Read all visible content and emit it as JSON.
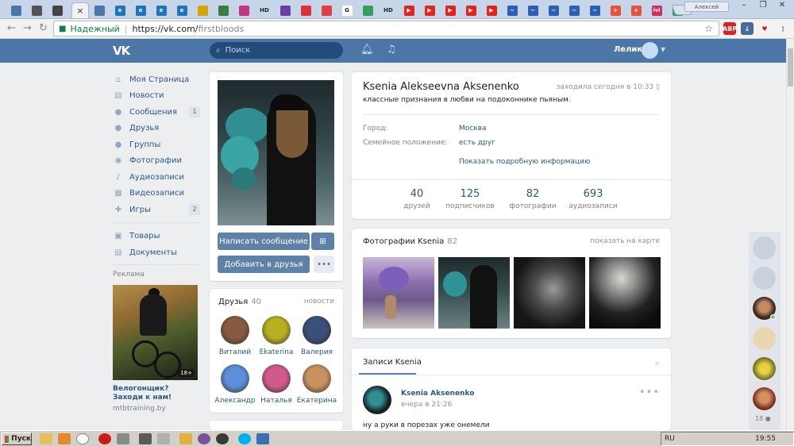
{
  "browser": {
    "window_user": "Алексей",
    "active_tab_close": "×",
    "tabs": [
      {
        "icon": "vk",
        "color": "#4a76a8",
        "text": ""
      },
      {
        "icon": "generic",
        "color": "#555",
        "text": ""
      },
      {
        "icon": "generic",
        "color": "#444",
        "text": ""
      },
      {
        "icon": "vk",
        "color": "#4a76a8",
        "text": ""
      },
      {
        "icon": "ie",
        "color": "#1e73be",
        "text": "e"
      },
      {
        "icon": "ie",
        "color": "#1e73be",
        "text": "e"
      },
      {
        "icon": "ie",
        "color": "#1e73be",
        "text": "e"
      },
      {
        "icon": "ie",
        "color": "#1e73be",
        "text": "e"
      },
      {
        "icon": "generic",
        "color": "#d8a200",
        "text": ""
      },
      {
        "icon": "generic",
        "color": "#3a7d44",
        "text": ""
      },
      {
        "icon": "instagram",
        "color": "#c13584",
        "text": ""
      },
      {
        "icon": "hd",
        "color": "#c6d5e8",
        "text": "HD"
      },
      {
        "icon": "generic",
        "color": "#6b3fa0",
        "text": ""
      },
      {
        "icon": "generic",
        "color": "#d33",
        "text": ""
      },
      {
        "icon": "generic",
        "color": "#e04040",
        "text": ""
      },
      {
        "icon": "google",
        "color": "#fff",
        "text": "G"
      },
      {
        "icon": "generic",
        "color": "#3a9d5d",
        "text": ""
      },
      {
        "icon": "hd",
        "color": "#c6d5e8",
        "text": "HD"
      },
      {
        "icon": "youtube",
        "color": "#e62117",
        "text": "▶"
      },
      {
        "icon": "youtube",
        "color": "#e62117",
        "text": "▶"
      },
      {
        "icon": "youtube",
        "color": "#e62117",
        "text": "▶"
      },
      {
        "icon": "youtube",
        "color": "#e62117",
        "text": "▶"
      },
      {
        "icon": "youtube",
        "color": "#e62117",
        "text": "▶"
      },
      {
        "icon": "chart",
        "color": "#2a5fb5",
        "text": "~"
      },
      {
        "icon": "chart",
        "color": "#2a5fb5",
        "text": "~"
      },
      {
        "icon": "chart",
        "color": "#2a5fb5",
        "text": "~"
      },
      {
        "icon": "chart",
        "color": "#2a5fb5",
        "text": "~"
      },
      {
        "icon": "chart",
        "color": "#2a5fb5",
        "text": "~"
      },
      {
        "icon": "plus",
        "color": "#e8503a",
        "text": "+"
      },
      {
        "icon": "plus",
        "color": "#e8503a",
        "text": "+"
      },
      {
        "icon": "ivi",
        "color": "#d42a5a",
        "text": "ivi"
      },
      {
        "icon": "generic",
        "color": "#2aa36b",
        "text": "W"
      }
    ],
    "secure_label": "Надежный",
    "url_scheme_host": "https://vk.com/",
    "url_path": "firstbloods"
  },
  "vk": {
    "logo": "VK",
    "search_placeholder": "Поиск",
    "username": "Лелик",
    "sidebar": [
      {
        "icon": "home-icon",
        "glyph": "⌂",
        "label": "Моя Страница",
        "badge": ""
      },
      {
        "icon": "news-icon",
        "glyph": "▤",
        "label": "Новости",
        "badge": ""
      },
      {
        "icon": "messages-icon",
        "glyph": "●",
        "label": "Сообщения",
        "badge": "1"
      },
      {
        "icon": "friend-icon",
        "glyph": "●",
        "label": "Друзья",
        "badge": ""
      },
      {
        "icon": "groups-icon",
        "glyph": "●",
        "label": "Группы",
        "badge": ""
      },
      {
        "icon": "camera-icon",
        "glyph": "◉",
        "label": "Фотографии",
        "badge": ""
      },
      {
        "icon": "music-icon",
        "glyph": "♪",
        "label": "Аудиозаписи",
        "badge": ""
      },
      {
        "icon": "video-icon",
        "glyph": "▦",
        "label": "Видеозаписи",
        "badge": ""
      },
      {
        "icon": "games-icon",
        "glyph": "✚",
        "label": "Игры",
        "badge": "2"
      }
    ],
    "sidebar2": [
      {
        "icon": "shop-icon",
        "glyph": "▣",
        "label": "Товары"
      },
      {
        "icon": "docs-icon",
        "glyph": "▤",
        "label": "Документы"
      }
    ],
    "ad": {
      "label": "Реклама",
      "age": "18+",
      "title": "Велогонщик? Заходи к нам!",
      "site": "mtbtraining.by"
    },
    "profile": {
      "name": "Ksenia Alekseevna Aksenenko",
      "last_seen": "заходила сегодня в 10:33",
      "status": "классные признания в любви на подоконнике пьяным.",
      "info": [
        {
          "label": "Город:",
          "value": "Москва"
        },
        {
          "label": "Семейное положение:",
          "value": "есть друг"
        }
      ],
      "show_more": "Показать подробную информацию",
      "stats": [
        {
          "num": "40",
          "label": "друзей"
        },
        {
          "num": "125",
          "label": "подписчиков"
        },
        {
          "num": "82",
          "label": "фотографии"
        },
        {
          "num": "693",
          "label": "аудиозаписи"
        }
      ],
      "btn_message": "Написать сообщение",
      "btn_add_friend": "Добавить в друзья",
      "gift_icon": "gift-icon",
      "more": "•••"
    },
    "friends": {
      "title": "Друзья",
      "count": "40",
      "link": "новости",
      "list": [
        {
          "name": "Виталий",
          "color": "#8a5a40"
        },
        {
          "name": "Ekaterina",
          "color": "#b8b020"
        },
        {
          "name": "Валерия",
          "color": "#3a4f7a"
        },
        {
          "name": "Александр",
          "color": "#5b8fd8"
        },
        {
          "name": "Наталья",
          "color": "#d05a8a"
        },
        {
          "name": "Екатерина",
          "color": "#c79260"
        }
      ]
    },
    "photos": {
      "title": "Фотографии Ksenia",
      "count": "82",
      "link": "показать на карте"
    },
    "wall": {
      "tab": "Записи Ksenia",
      "author": "Ksenia Aksenenko",
      "date": "вчера в 21:26",
      "text": "ну а руки в порезах уже онемели"
    },
    "chat": {
      "count": "18"
    }
  },
  "taskbar": {
    "start": "Пуск",
    "lang": "RU",
    "time": "19:55"
  }
}
